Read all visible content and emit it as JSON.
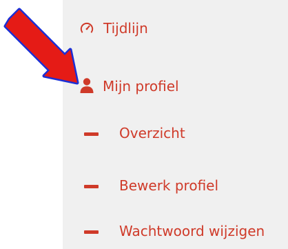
{
  "menu": {
    "items": [
      {
        "label": "Tijdlijn",
        "icon": "speedometer-icon"
      },
      {
        "label": "Mijn profiel",
        "icon": "user-icon"
      }
    ],
    "subitems": [
      {
        "label": "Overzicht",
        "icon": "dash-icon"
      },
      {
        "label": "Bewerk profiel",
        "icon": "dash-icon"
      },
      {
        "label": "Wachtwoord wijzigen",
        "icon": "dash-icon"
      }
    ]
  },
  "colors": {
    "accent": "#cf3a29",
    "panel_background": "#f0f0f0",
    "annotation_arrow_fill": "#e51b16",
    "annotation_arrow_outline": "#1a2fd6"
  }
}
